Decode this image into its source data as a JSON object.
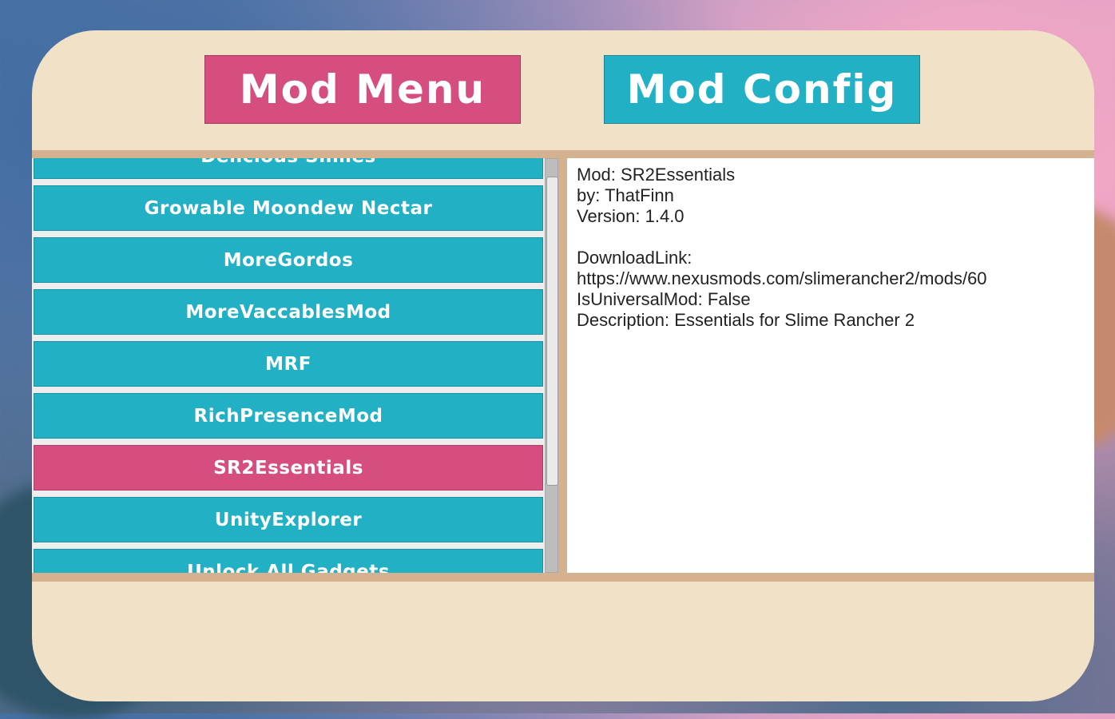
{
  "tabs": {
    "mod_menu": "Mod Menu",
    "mod_config": "Mod Config"
  },
  "mods": [
    "Delicious Slimes",
    "Growable Moondew Nectar",
    "MoreGordos",
    "MoreVaccablesMod",
    "MRF",
    "RichPresenceMod",
    "SR2Essentials",
    "UnityExplorer",
    "Unlock All Gadgets"
  ],
  "selected_mod": "SR2Essentials",
  "details": {
    "mod": "Mod: SR2Essentials",
    "author": "by: ThatFinn",
    "version": "Version: 1.4.0",
    "download_label": "DownloadLink:",
    "download_url": "https://www.nexusmods.com/slimerancher2/mods/60",
    "universal": "IsUniversalMod: False",
    "description": "Description: Essentials for Slime Rancher 2"
  },
  "colors": {
    "accent_pink": "#d64e80",
    "accent_teal": "#22b0c4",
    "panel": "#f0e1c7",
    "band": "#d4b18f"
  }
}
